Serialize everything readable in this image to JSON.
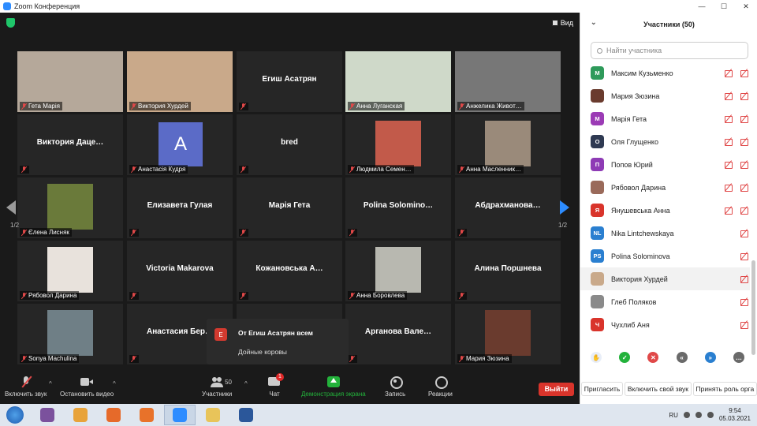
{
  "window": {
    "title": "Zoom Конференция",
    "controls": [
      "—",
      "☐",
      "✕"
    ]
  },
  "view_label": "Вид",
  "pager": {
    "left": "1/2",
    "right": "1/2"
  },
  "tiles": [
    {
      "name": "Гета Марія",
      "type": "video",
      "color": "#b5a89a"
    },
    {
      "name": "Виктория Хурдей",
      "type": "video",
      "color": "#c9a98a"
    },
    {
      "center": "Егиш Асатрян",
      "type": "name"
    },
    {
      "name": "Анна Луганская",
      "type": "video",
      "color": "#cfd9c9",
      "active": true
    },
    {
      "name": "Анжелика Живот…",
      "type": "video",
      "color": "#777"
    },
    {
      "center": "Виктория  Даце…",
      "type": "name"
    },
    {
      "name": "Анастасія Кудря",
      "type": "avatar",
      "letter": "A"
    },
    {
      "center": "bred",
      "type": "name"
    },
    {
      "name": "Людмила Семен…",
      "type": "video",
      "color": "#c25a4a"
    },
    {
      "name": "Анна Масленник…",
      "type": "video",
      "color": "#9a8a7a"
    },
    {
      "name": "Єлена Лисняк",
      "type": "video",
      "color": "#6a7a3a"
    },
    {
      "center": "Елизавета Гулая",
      "type": "name"
    },
    {
      "center": "Марія Гета",
      "type": "name"
    },
    {
      "center": "Polina  Solomino…",
      "type": "name"
    },
    {
      "center": "Абдрахманова…",
      "type": "name"
    },
    {
      "name": "Рябовол Дарина",
      "type": "video",
      "color": "#e8e2dc"
    },
    {
      "center": "Victoria Makarova",
      "type": "name"
    },
    {
      "center": "Кожановська  А…",
      "type": "name"
    },
    {
      "name": "Анна Боровлева",
      "type": "video",
      "color": "#b8b8b0"
    },
    {
      "center": "Алина Поршнева",
      "type": "name"
    },
    {
      "name": "Sonya Machulina",
      "type": "video",
      "color": "#6f7f86"
    },
    {
      "center": "Анастасия  Бер…",
      "type": "name"
    },
    {
      "center": "",
      "type": "blank"
    },
    {
      "center": "Арганова  Вале…",
      "type": "name"
    },
    {
      "name": "Мария Зюзина",
      "type": "video",
      "color": "#6a3b2e"
    }
  ],
  "chat_popup": {
    "avatar": "Е",
    "from": "От Егиш Асатрян всем",
    "message": "Дойные коровы"
  },
  "toolbar": {
    "mute": "Включить звук",
    "video": "Остановить видео",
    "participants": "Участники",
    "participants_count": "50",
    "chat": "Чат",
    "chat_badge": "1",
    "share": "Демонстрация экрана",
    "record": "Запись",
    "reactions": "Реакции",
    "leave": "Выйти"
  },
  "panel": {
    "title": "Участники (50)",
    "search_placeholder": "Найти участника",
    "participants": [
      {
        "initials": "М",
        "name": "Максим Кузьменко",
        "color": "#2e9a5a",
        "mic_off": true
      },
      {
        "initials": "",
        "name": "Мария Зюзина",
        "color": "#6a3b2e",
        "mic_off": true
      },
      {
        "initials": "М",
        "name": "Марія Гета",
        "color": "#9b3bb5",
        "mic_off": true
      },
      {
        "initials": "О",
        "name": "Оля Глущенко",
        "color": "#2f3a52",
        "mic_off": true
      },
      {
        "initials": "П",
        "name": "Попов Юрий",
        "color": "#8e3bb5",
        "mic_off": true
      },
      {
        "initials": "",
        "name": "Рябовол Дарина",
        "color": "#9a6a5a",
        "mic_off": true
      },
      {
        "initials": "Я",
        "name": "Янушевська Анна",
        "color": "#d9342b",
        "mic_off": true
      },
      {
        "initials": "NL",
        "name": "Nika Lintchewskaya",
        "color": "#2a7fd0",
        "mic_off": false
      },
      {
        "initials": "PS",
        "name": "Polina Solominova",
        "color": "#2a7fd0",
        "mic_off": false
      },
      {
        "initials": "",
        "name": "Виктория  Хурдей",
        "color": "#c9a98a",
        "mic_off": false,
        "highlight": true
      },
      {
        "initials": "",
        "name": "Глеб Поляков",
        "color": "#8a8a8a",
        "mic_off": false
      },
      {
        "initials": "Ч",
        "name": "Чухлиб Аня",
        "color": "#d9342b",
        "mic_off": false
      }
    ],
    "reactions": [
      {
        "symbol": "✋",
        "color": "#e8eef8",
        "text_color": "#2a7fd0"
      },
      {
        "symbol": "✓",
        "color": "#23b23b",
        "text_color": "#fff"
      },
      {
        "symbol": "✕",
        "color": "#e04848",
        "text_color": "#fff"
      },
      {
        "symbol": "«",
        "color": "#6a6a6a",
        "text_color": "#fff"
      },
      {
        "symbol": "»",
        "color": "#2a7fd0",
        "text_color": "#fff"
      },
      {
        "symbol": "…",
        "color": "#6a6a6a",
        "text_color": "#fff"
      }
    ],
    "buttons": [
      "Пригласить",
      "Включить свой звук",
      "Принять роль орга"
    ]
  },
  "taskbar": {
    "lang": "RU",
    "time": "9:54",
    "date": "05.03.2021",
    "apps": [
      {
        "name": "viber-icon",
        "color": "#7b519d"
      },
      {
        "name": "chrome-icon",
        "color": "#e8a33a"
      },
      {
        "name": "media-player-icon",
        "color": "#e66a2a"
      },
      {
        "name": "firefox-icon",
        "color": "#e8722a"
      },
      {
        "name": "zoom-icon",
        "color": "#2d8cff"
      },
      {
        "name": "file-explorer-icon",
        "color": "#e8c45a"
      },
      {
        "name": "word-icon",
        "color": "#2b579a"
      }
    ]
  }
}
